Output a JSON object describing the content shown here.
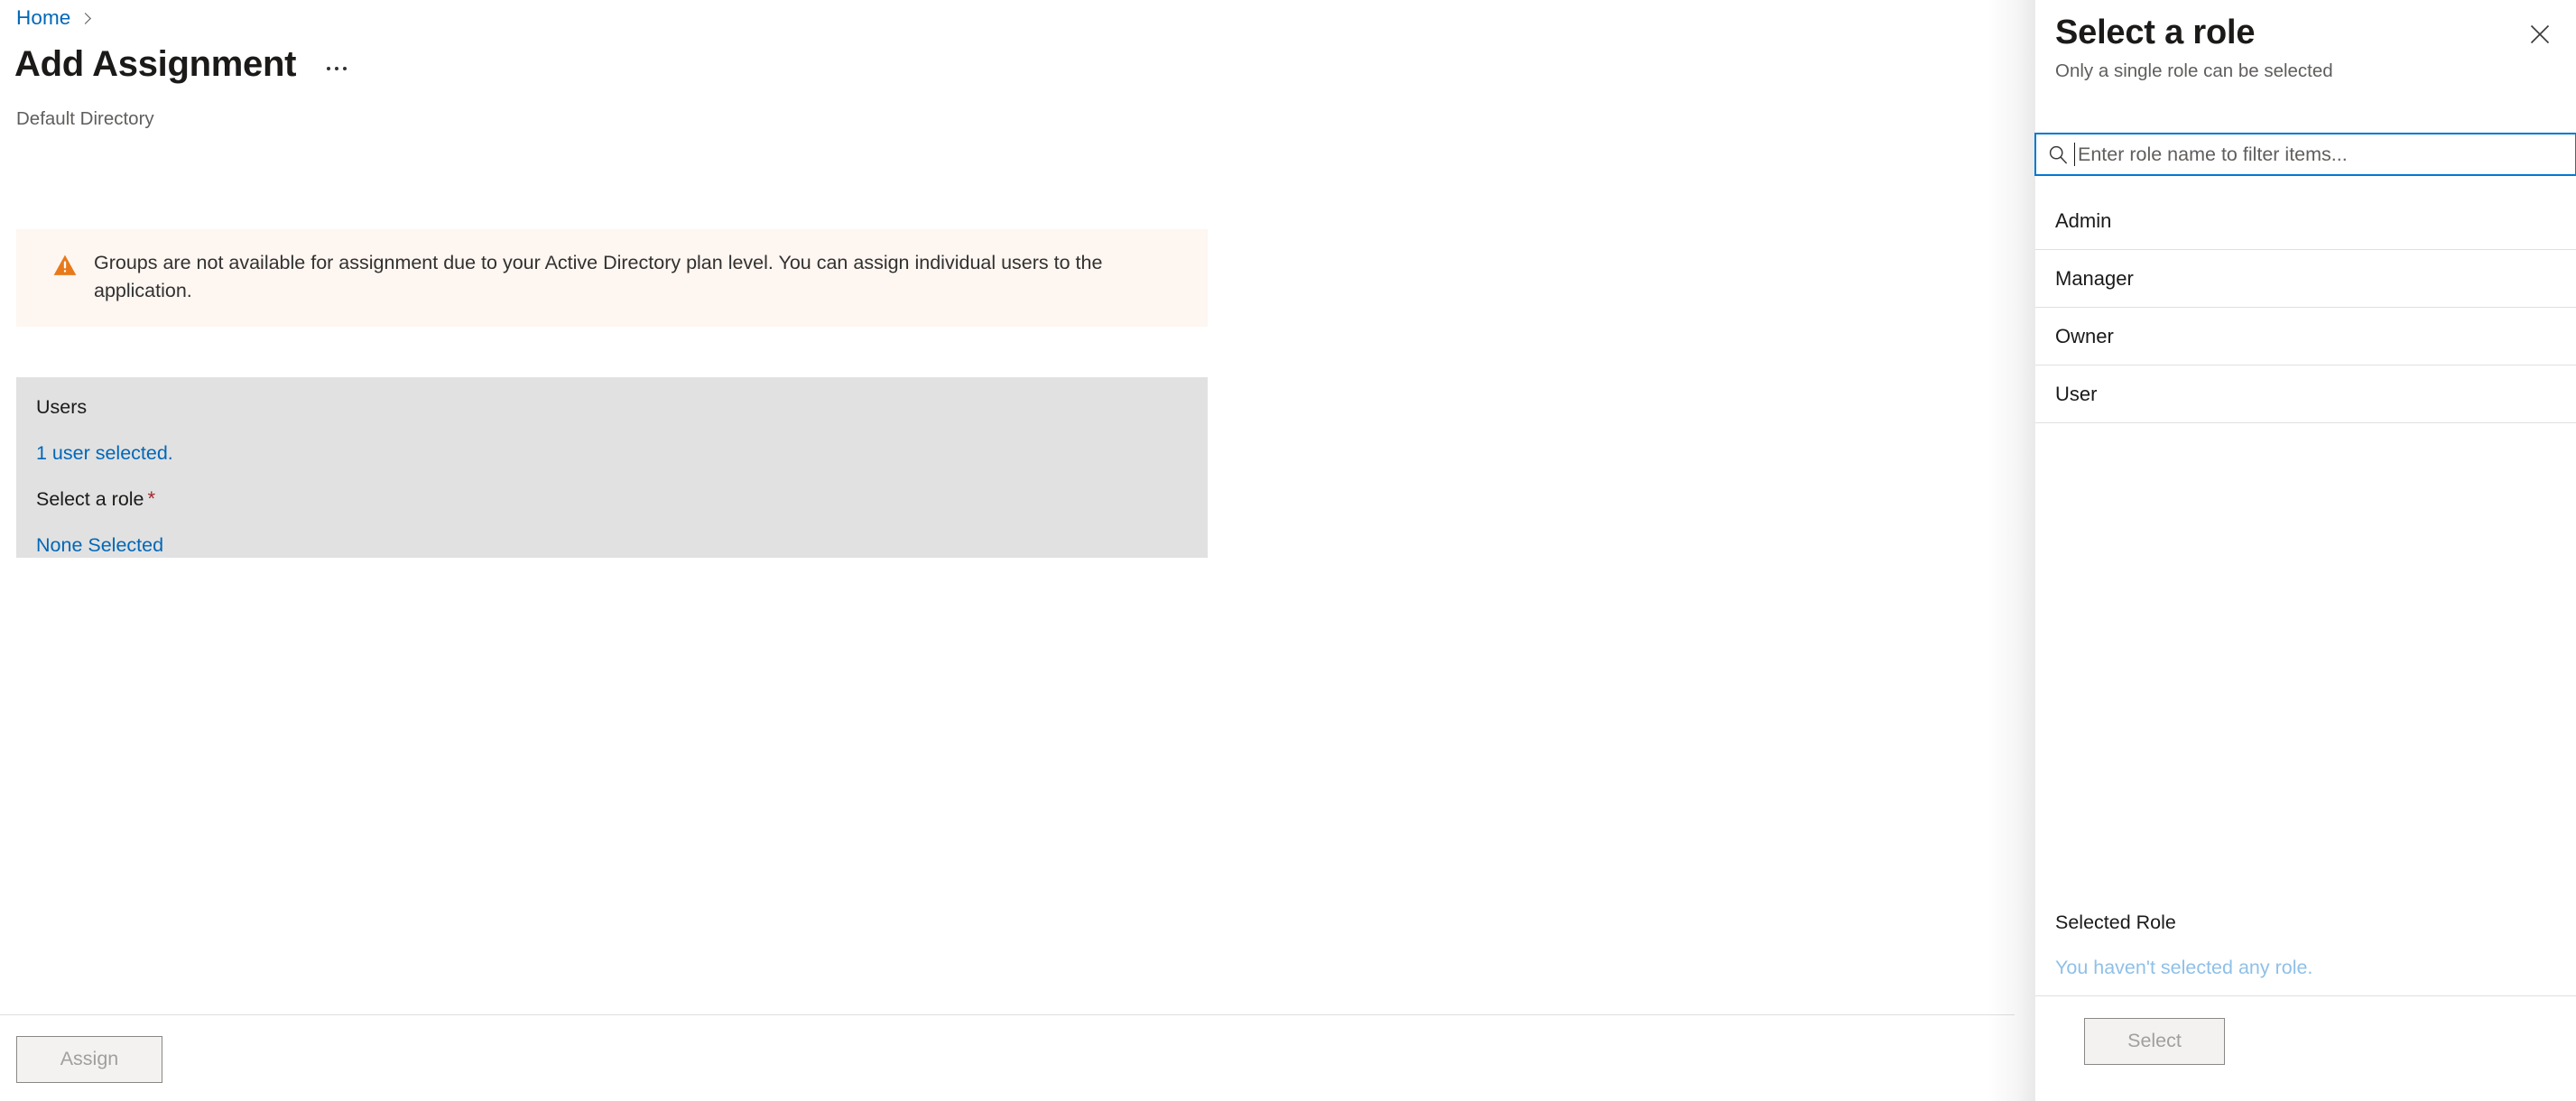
{
  "breadcrumb": {
    "items": [
      {
        "label": "Home",
        "icon": "chevron-right-icon"
      }
    ]
  },
  "header": {
    "title": "Add Assignment",
    "subtitle": "Default Directory",
    "more_menu_icon": "ellipsis-icon"
  },
  "warning": {
    "icon": "warning-triangle-icon",
    "icon_color": "#e8791a",
    "background_color": "#fdf6f1",
    "message": "Groups are not available for assignment due to your Active Directory plan level. You can assign individual users to the application."
  },
  "form": {
    "background_color": "#e1e1e1",
    "users_label": "Users",
    "users_value": "1 user selected.",
    "role_label": "Select a role",
    "role_required_marker": "*",
    "role_value": "None Selected",
    "link_color": "#0067b8",
    "required_color": "#a4262c"
  },
  "footer": {
    "assign_label": "Assign",
    "assign_disabled": true
  },
  "pane": {
    "title": "Select a role",
    "subtitle": "Only a single role can be selected",
    "close_icon": "close-icon",
    "accent_color": "#0078d4",
    "search": {
      "icon": "search-icon",
      "placeholder": "Enter role name to filter items...",
      "value": ""
    },
    "roles": [
      {
        "name": "Admin"
      },
      {
        "name": "Manager"
      },
      {
        "name": "Owner"
      },
      {
        "name": "User"
      }
    ],
    "selected_role": {
      "label": "Selected Role",
      "empty_text": "You haven't selected any role.",
      "empty_text_color": "#8fc0e8"
    },
    "select_button": {
      "label": "Select",
      "disabled": true
    }
  }
}
